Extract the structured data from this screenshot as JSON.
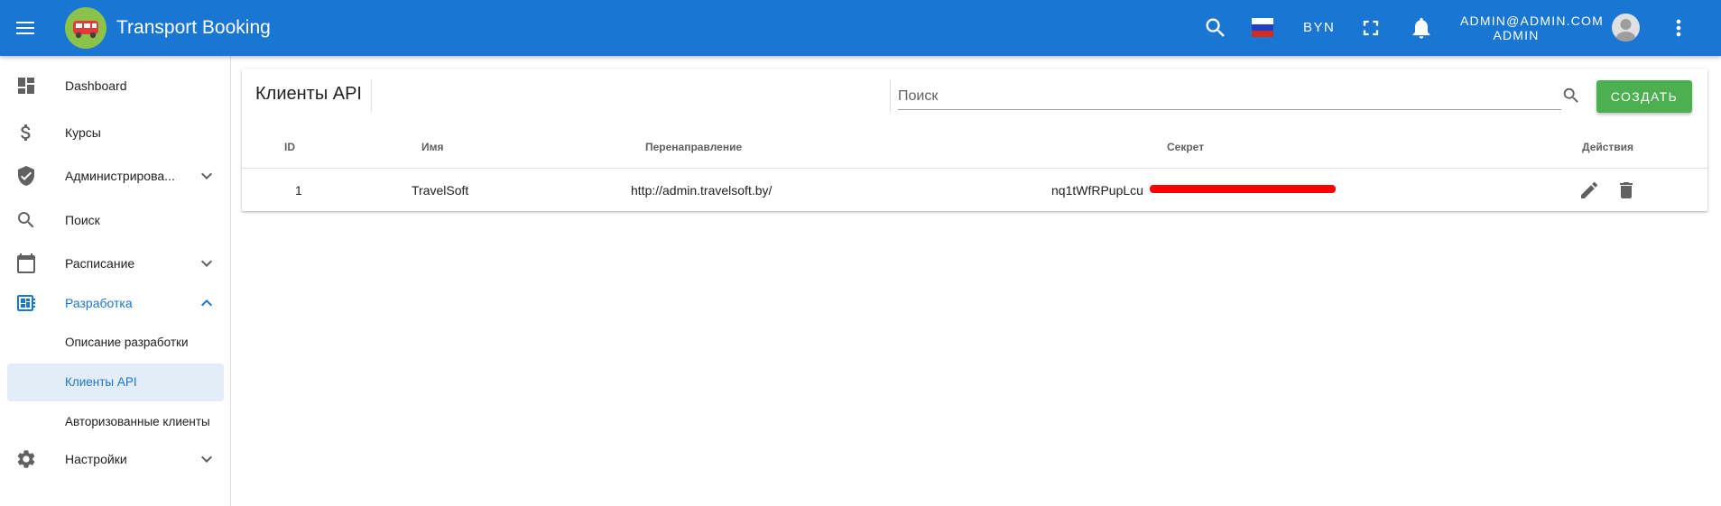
{
  "app": {
    "title": "Transport Booking"
  },
  "header": {
    "currency": "BYN",
    "user_email": "ADMIN@ADMIN.COM",
    "user_role": "ADMIN",
    "brand_color": "#1976d2"
  },
  "sidebar": {
    "items": [
      {
        "label": "Dashboard",
        "icon": "dashboard-icon"
      },
      {
        "label": "Курсы",
        "icon": "dollar-icon"
      },
      {
        "label": "Администрирова...",
        "icon": "shield-check-icon"
      },
      {
        "label": "Поиск",
        "icon": "search-icon"
      },
      {
        "label": "Расписание",
        "icon": "calendar-icon"
      },
      {
        "label": "Разработка",
        "icon": "developer-board-icon"
      },
      {
        "label": "Настройки",
        "icon": "gear-icon"
      }
    ],
    "sub_items": [
      {
        "label": "Описание разработки"
      },
      {
        "label": "Клиенты API"
      },
      {
        "label": "Авторизованные клиенты"
      }
    ]
  },
  "main": {
    "title": "Клиенты API",
    "search_placeholder": "Поиск",
    "create_label": "СОЗДАТЬ",
    "columns": [
      "ID",
      "Имя",
      "Перенаправление",
      "Секрет",
      "Действия"
    ],
    "rows": [
      {
        "id": "1",
        "name": "TravelSoft",
        "redirect": "http://admin.travelsoft.by/",
        "secret": "nq1tWfRPupLcu"
      }
    ]
  },
  "colors": {
    "accent": "#1976d2",
    "success": "#4caf50",
    "redaction": "#ff0000"
  }
}
